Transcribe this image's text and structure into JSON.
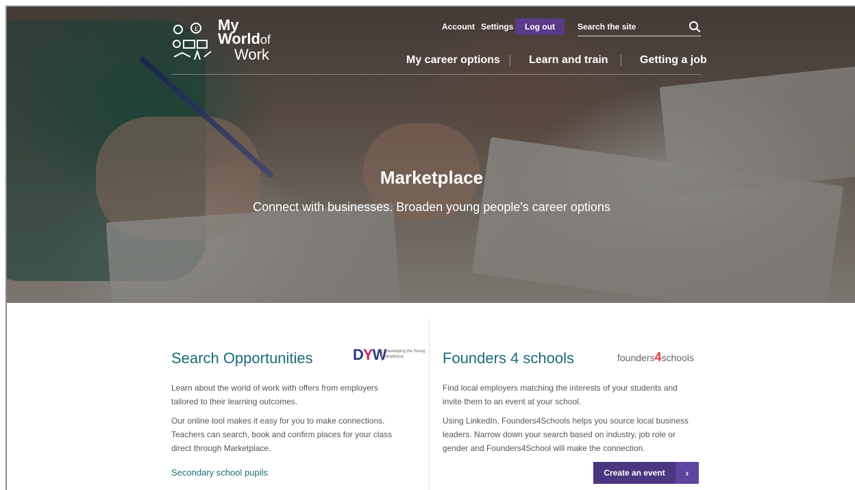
{
  "logo": {
    "line1": "My",
    "line2": "World",
    "line2_small": "of",
    "line3": "Work"
  },
  "utility": {
    "account": "Account",
    "settings": "Settings",
    "logout": "Log out",
    "search_placeholder": "Search the site"
  },
  "nav": {
    "items": [
      {
        "label": "My career options"
      },
      {
        "label": "Learn and train"
      },
      {
        "label": "Getting a job"
      }
    ]
  },
  "hero": {
    "title": "Marketplace",
    "subtitle": "Connect with businesses. Broaden young people's career options"
  },
  "left": {
    "title": "Search Opportunities",
    "logo_mark": "DYW",
    "logo_small": "Developing the Young Workforce",
    "para1": "Learn about the world of work with offers from employers tailored to their learning outcomes.",
    "para2": "Our online tool makes it easy for you to make connections. Teachers can search, book and confirm places for your class direct through Marketplace.",
    "link": "Secondary school pupils"
  },
  "right": {
    "title": "Founders 4 schools",
    "logo_a": "founders",
    "logo_b": "4",
    "logo_c": "schools",
    "para1": "Find local employers matching the interests of your students and invite them to an event at your school.",
    "para2": "Using LinkedIn, Founders4Schools helps you source local business leaders. Narrow down your search based on industry, job role or gender and Founders4School will make the connection.",
    "cta": "Create an event",
    "cta_arrow": "›"
  },
  "colors": {
    "teal": "#1b6b7a",
    "purple": "#4b3680",
    "logout": "#5b3a8a",
    "f4s_red": "#e0393e"
  }
}
